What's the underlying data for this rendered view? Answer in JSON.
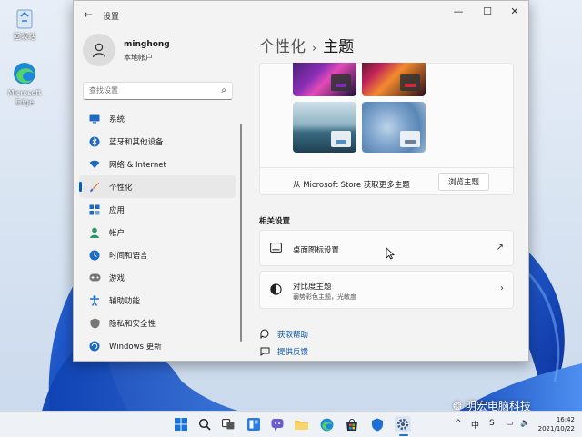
{
  "desktop": {
    "icons": [
      {
        "label": "回收站",
        "icon": "recycle-bin-icon"
      },
      {
        "label": "Microsoft Edge",
        "icon": "edge-icon"
      }
    ],
    "watermark": "明宏电脑科技"
  },
  "window": {
    "title": "设置",
    "controls": {
      "minimize": "—",
      "maximize": "☐",
      "close": "✕"
    }
  },
  "profile": {
    "name": "minghong",
    "account_type": "本地帐户"
  },
  "search": {
    "placeholder": "查找设置"
  },
  "nav": {
    "items": [
      {
        "label": "系统",
        "icon": "monitor-icon",
        "color": "#1c6bc1"
      },
      {
        "label": "蓝牙和其他设备",
        "icon": "bluetooth-icon",
        "color": "#1c6bc1"
      },
      {
        "label": "网络 & Internet",
        "icon": "wifi-icon",
        "color": "#1c6bc1"
      },
      {
        "label": "个性化",
        "icon": "brush-icon",
        "color": "#e2773c",
        "selected": true
      },
      {
        "label": "应用",
        "icon": "apps-icon",
        "color": "#1c6bc1"
      },
      {
        "label": "帐户",
        "icon": "person-icon",
        "color": "#2b9a6b"
      },
      {
        "label": "时间和语言",
        "icon": "globe-clock-icon",
        "color": "#1c6bc1"
      },
      {
        "label": "游戏",
        "icon": "gamepad-icon",
        "color": "#777777"
      },
      {
        "label": "辅助功能",
        "icon": "accessibility-icon",
        "color": "#1c6bc1"
      },
      {
        "label": "隐私和安全性",
        "icon": "shield-icon",
        "color": "#777777"
      },
      {
        "label": "Windows 更新",
        "icon": "update-icon",
        "color": "#1c6bc1"
      }
    ]
  },
  "breadcrumb": {
    "parent": "个性化",
    "separator": "›",
    "current": "主题"
  },
  "themes": {
    "store_text": "从 Microsoft Store 获取更多主题",
    "browse_button": "浏览主题"
  },
  "related": {
    "heading": "相关设置",
    "desktop_icons": {
      "title": "桌面图标设置",
      "trail_icon": "external-link-icon"
    },
    "contrast": {
      "title": "对比度主题",
      "subtitle": "弱势彩色主题，光敏度",
      "trail_icon": "chevron-right-icon"
    }
  },
  "links": {
    "help": "获取帮助",
    "feedback": "提供反馈"
  },
  "taskbar": {
    "tray": {
      "chevron": "^",
      "ime": "中",
      "lang": "S"
    },
    "time": "16:42",
    "date": "2021/10/22"
  },
  "colors": {
    "accent": "#005fb8",
    "link": "#0a55a8"
  }
}
